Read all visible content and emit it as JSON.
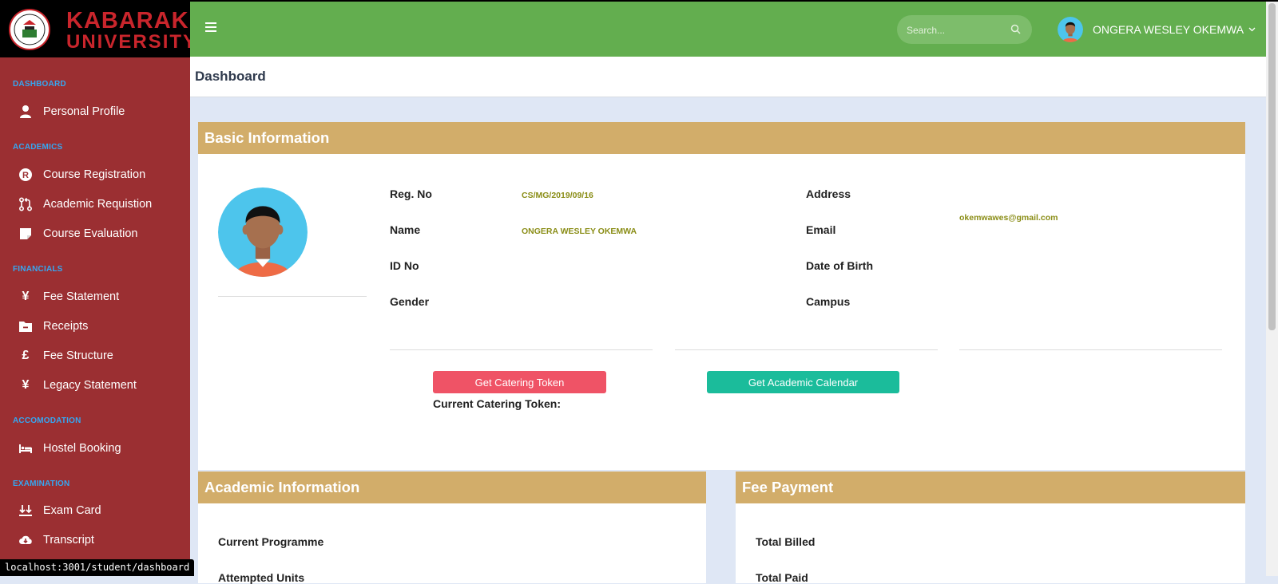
{
  "brand": {
    "line1": "KABARAK",
    "line2": "UNIVERSITY"
  },
  "sidebar": {
    "sections": [
      {
        "title": "DASHBOARD",
        "items": [
          {
            "label": "Personal Profile",
            "icon": "user-icon"
          }
        ]
      },
      {
        "title": "ACADEMICS",
        "items": [
          {
            "label": "Course Registration",
            "icon": "registered-icon"
          },
          {
            "label": "Academic Requistion",
            "icon": "git-pull-request-icon"
          },
          {
            "label": "Course Evaluation",
            "icon": "sticky-note-icon"
          }
        ]
      },
      {
        "title": "FINANCIALS",
        "items": [
          {
            "label": "Fee Statement",
            "icon": "yen-icon"
          },
          {
            "label": "Receipts",
            "icon": "folder-minus-icon"
          },
          {
            "label": "Fee Structure",
            "icon": "pound-icon"
          },
          {
            "label": "Legacy Statement",
            "icon": "yen-icon"
          }
        ]
      },
      {
        "title": "ACCOMODATION",
        "items": [
          {
            "label": "Hostel Booking",
            "icon": "bed-icon"
          }
        ]
      },
      {
        "title": "EXAMINATION",
        "items": [
          {
            "label": "Exam Card",
            "icon": "download-arrows-icon"
          },
          {
            "label": "Transcript",
            "icon": "cloud-download-icon"
          }
        ]
      }
    ]
  },
  "header": {
    "search_placeholder": "Search...",
    "user_name": "ONGERA WESLEY OKEMWA"
  },
  "page": {
    "title": "Dashboard"
  },
  "basic_info": {
    "title": "Basic Information",
    "reg_no_label": "Reg. No",
    "reg_no": "CS/MG/2019/09/16",
    "name_label": "Name",
    "name": "ONGERA WESLEY OKEMWA",
    "id_label": "ID No",
    "gender_label": "Gender",
    "address_label": "Address",
    "email_label": "Email",
    "email": "okemwawes@gmail.com",
    "dob_label": "Date of Birth",
    "campus_label": "Campus",
    "catering_button": "Get Catering Token",
    "calendar_button": "Get Academic Calendar",
    "catering_token_label": "Current Catering Token:"
  },
  "academic_info": {
    "title": "Academic Information",
    "programme_label": "Current Programme",
    "attempted_label": "Attempted Units"
  },
  "fee_payment": {
    "title": "Fee Payment",
    "billed_label": "Total Billed",
    "paid_label": "Total Paid"
  },
  "status_bar": {
    "url": "localhost:3001/student/dashboard"
  },
  "colors": {
    "sidebar": "#9b2f32",
    "topbar": "#63ae4f",
    "card_header": "#d2ad6a",
    "catering_button": "#ef5366",
    "calendar_button": "#1bbc9b",
    "section_title": "#35a7f2"
  }
}
